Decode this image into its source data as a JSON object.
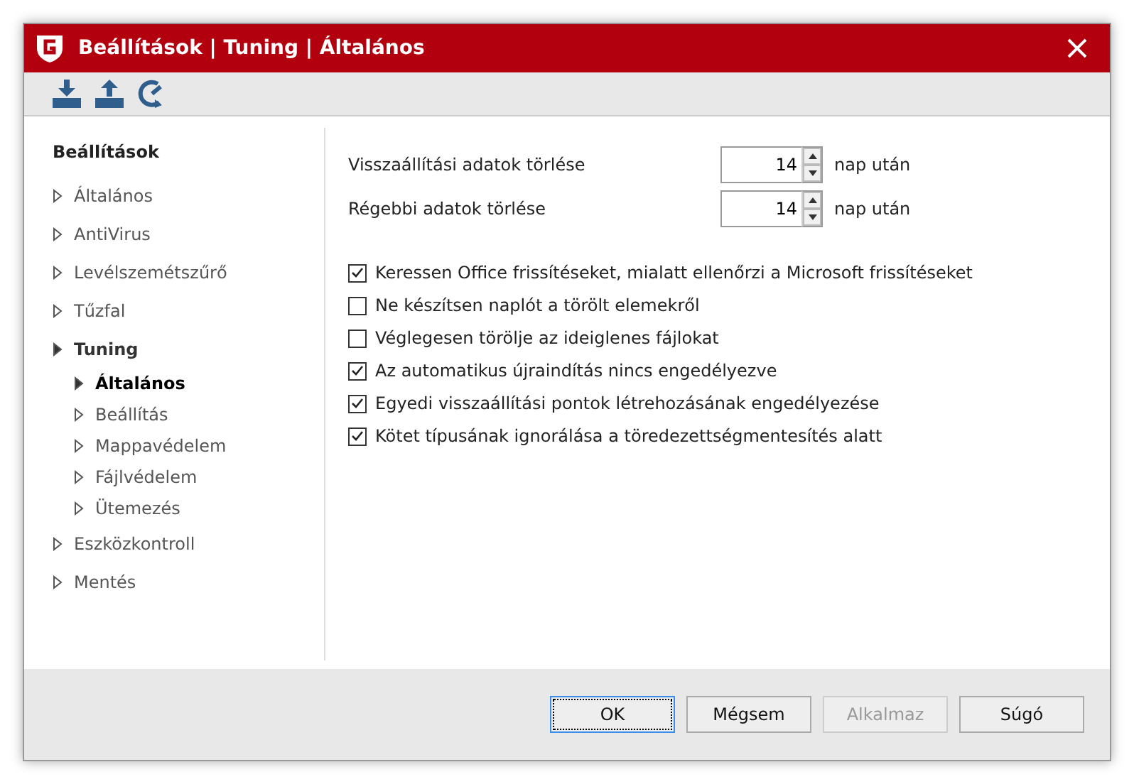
{
  "window": {
    "title": "Beállítások | Tuning | Általános"
  },
  "toolbar": [
    {
      "kind": "import"
    },
    {
      "kind": "export"
    },
    {
      "kind": "reset"
    }
  ],
  "sidebar": {
    "heading": "Beállítások",
    "items": [
      {
        "label": "Általános",
        "expanded": false,
        "selected": false
      },
      {
        "label": "AntiVirus",
        "expanded": false,
        "selected": false
      },
      {
        "label": "Levélszemétszűrő",
        "expanded": false,
        "selected": false
      },
      {
        "label": "Tűzfal",
        "expanded": false,
        "selected": false
      },
      {
        "label": "Tuning",
        "expanded": true,
        "selected": false,
        "children": [
          {
            "label": "Általános",
            "expanded": false,
            "selected": true
          },
          {
            "label": "Beállítás",
            "expanded": false,
            "selected": false
          },
          {
            "label": "Mappavédelem",
            "expanded": false,
            "selected": false
          },
          {
            "label": "Fájlvédelem",
            "expanded": false,
            "selected": false
          },
          {
            "label": "Ütemezés",
            "expanded": false,
            "selected": false
          }
        ]
      },
      {
        "label": "Eszközkontroll",
        "expanded": false,
        "selected": false
      },
      {
        "label": "Mentés",
        "expanded": false,
        "selected": false
      }
    ]
  },
  "spinners": [
    {
      "label": "Visszaállítási adatok törlése",
      "value": "14",
      "unit": "nap után"
    },
    {
      "label": "Régebbi adatok törlése",
      "value": "14",
      "unit": "nap után"
    }
  ],
  "checkboxes": [
    {
      "label": "Keressen Office frissítéseket, mialatt ellenőrzi a Microsoft frissítéseket",
      "checked": true
    },
    {
      "label": "Ne készítsen naplót a törölt elemekről",
      "checked": false
    },
    {
      "label": "Véglegesen törölje az ideiglenes fájlokat",
      "checked": false
    },
    {
      "label": "Az automatikus újraindítás nincs engedélyezve",
      "checked": true
    },
    {
      "label": "Egyedi visszaállítási pontok létrehozásának engedélyezése",
      "checked": true
    },
    {
      "label": "Kötet típusának ignorálása a töredezettségmentesítés alatt",
      "checked": true
    }
  ],
  "buttons": [
    {
      "label": "OK",
      "default": true,
      "disabled": false
    },
    {
      "label": "Mégsem",
      "default": false,
      "disabled": false
    },
    {
      "label": "Alkalmaz",
      "default": false,
      "disabled": true
    },
    {
      "label": "Súgó",
      "default": false,
      "disabled": false
    }
  ]
}
